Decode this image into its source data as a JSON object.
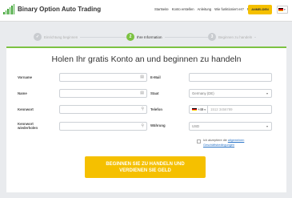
{
  "brand": {
    "name": "Binary Option Auto Trading",
    "accent": "#7cc242",
    "button_color": "#f5c000"
  },
  "nav": {
    "items": [
      "Startseite",
      "Konto erstellen",
      "Anleitung",
      "Wie funktioniert es?",
      "FAQ"
    ],
    "login_label": "ANMELDEN",
    "language_icon": "german-flag-icon"
  },
  "steps": [
    {
      "number": "1",
      "label": "Einrichtung beginnen",
      "state": "done"
    },
    {
      "number": "2",
      "label": "Ihre Information",
      "state": "active"
    },
    {
      "number": "3",
      "label": "Beginnen zu handeln",
      "state": "todo"
    }
  ],
  "form": {
    "title": "Holen Ihr gratis Konto an und beginnen zu handeln",
    "fields": {
      "first_name": {
        "label": "Vorname",
        "value": ""
      },
      "last_name": {
        "label": "Name",
        "value": ""
      },
      "password": {
        "label": "Kennwort",
        "value": ""
      },
      "password_confirm": {
        "label": "Kennwort wiederholen",
        "value": ""
      },
      "email": {
        "label": "E-Mail",
        "value": ""
      },
      "country": {
        "label": "Staat",
        "value": "Germany (DE)"
      },
      "phone": {
        "label": "Telefon",
        "prefix": "+49",
        "placeholder": "1512 3456789"
      },
      "currency": {
        "label": "Währung",
        "value": "USD"
      }
    },
    "terms_text": "Ich akzeptiere die",
    "terms_link": "allgemeinen Geschäftsbedingungen",
    "submit_label": "BEGINNEN SIE ZU HANDELN UND VERDIENEN SIE GELD"
  }
}
